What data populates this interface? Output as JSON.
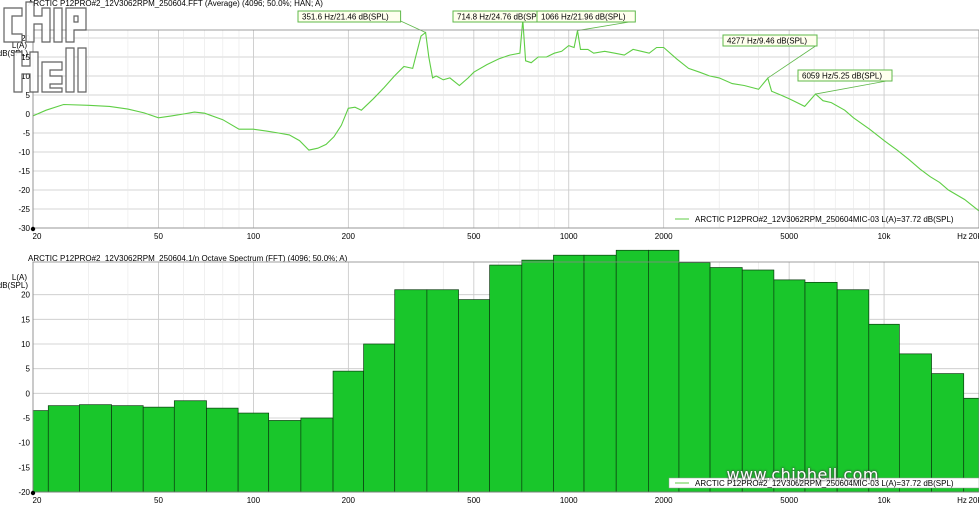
{
  "top_title": "ARCTIC P12PRO#2_12V3062RPM_250604.FFT (Average) (4096; 50.0%; HAN; A)",
  "bottom_title": "ARCTIC P12PRO#2_12V3062RPM_250604.1/n Octave Spectrum (FFT) (4096; 50.0%; A)",
  "watermark": "www.chiphell.com",
  "logo_text": "chip hell",
  "colors": {
    "line": "#5fce45",
    "bar": "#19c62b",
    "grid": "#c8c8c8",
    "callout_bg": "#ffffee",
    "callout_border": "#5fb84a"
  },
  "chart_data": [
    {
      "type": "line",
      "title": "ARCTIC P12PRO#2_12V3062RPM_250604.FFT (Average) (4096; 50.0%; HAN; A)",
      "ylabel": "L(A) dB(SPL)",
      "xlabel": "Hz",
      "xscale": "log",
      "xlim": [
        20,
        20000
      ],
      "ylim": [
        -30,
        20
      ],
      "yticks": [
        20,
        15,
        10,
        5,
        0,
        -5,
        -10,
        -15,
        -20,
        -25,
        -30
      ],
      "xticks": [
        20,
        50,
        100,
        200,
        500,
        1000,
        2000,
        5000,
        10000,
        20000
      ],
      "xtick_labels": [
        "20",
        "50",
        "100",
        "200",
        "500",
        "1000",
        "2000",
        "5000",
        "10k",
        "Hz",
        "20k"
      ],
      "grid": true,
      "legend_position": "bottom-right",
      "series": [
        {
          "name": "ARCTIC P12PRO#2_12V3062RPM_250604MIC-03 L(A)=37.72 dB(SPL)",
          "x": [
            20,
            22,
            25,
            30,
            35,
            40,
            45,
            50,
            55,
            60,
            65,
            70,
            80,
            90,
            100,
            110,
            120,
            130,
            140,
            150,
            160,
            170,
            180,
            190,
            200,
            210,
            220,
            240,
            260,
            280,
            300,
            320,
            340,
            351.6,
            360,
            370,
            380,
            400,
            420,
            450,
            480,
            500,
            550,
            600,
            650,
            700,
            714.8,
            730,
            760,
            800,
            850,
            900,
            950,
            1000,
            1040,
            1066,
            1090,
            1150,
            1200,
            1300,
            1400,
            1500,
            1600,
            1700,
            1800,
            1900,
            2000,
            2200,
            2400,
            2600,
            2800,
            3000,
            3300,
            3600,
            4000,
            4277,
            4400,
            4700,
            5000,
            5300,
            5600,
            6059,
            6400,
            6800,
            7500,
            8000,
            9000,
            10000,
            11000,
            12000,
            13000,
            14000,
            15000,
            16000,
            18000,
            20000
          ],
          "y": [
            -0.5,
            1.0,
            2.5,
            2.3,
            2.0,
            1.3,
            0.3,
            -1.0,
            -0.5,
            0.0,
            0.5,
            0.2,
            -1.5,
            -4.0,
            -4.0,
            -4.5,
            -5.0,
            -5.5,
            -7.0,
            -9.5,
            -9.0,
            -8.0,
            -6.0,
            -3.0,
            1.5,
            1.8,
            1.0,
            4.0,
            7.0,
            10.0,
            12.5,
            12.0,
            20.5,
            21.46,
            15.0,
            9.5,
            10.0,
            9.0,
            9.5,
            7.5,
            9.5,
            11.0,
            13.0,
            14.5,
            15.5,
            16.0,
            24.76,
            14.0,
            13.5,
            15.0,
            15.0,
            16.0,
            16.5,
            18.0,
            17.5,
            21.96,
            17.0,
            17.0,
            16.0,
            16.5,
            16.0,
            15.5,
            17.0,
            16.5,
            16.0,
            17.5,
            17.5,
            14.5,
            12.0,
            11.0,
            10.0,
            9.5,
            8.0,
            7.5,
            6.5,
            9.46,
            6.0,
            5.0,
            4.0,
            3.0,
            2.0,
            5.25,
            3.5,
            3.0,
            1.0,
            -1.0,
            -4.0,
            -7.0,
            -9.5,
            -12.0,
            -14.5,
            -16.5,
            -18.0,
            -20.0,
            -22.5,
            -25.5
          ]
        }
      ],
      "annotations": [
        {
          "x": 351.6,
          "y": 21.46,
          "label": "351.6 Hz/21.46 dB(SPL)"
        },
        {
          "x": 714.8,
          "y": 24.76,
          "label": "714.8 Hz/24.76 dB(SPL)"
        },
        {
          "x": 1066,
          "y": 21.96,
          "label": "1066 Hz/21.96 dB(SPL)"
        },
        {
          "x": 4277,
          "y": 9.46,
          "label": "4277 Hz/9.46 dB(SPL)"
        },
        {
          "x": 6059,
          "y": 5.25,
          "label": "6059 Hz/5.25 dB(SPL)"
        }
      ]
    },
    {
      "type": "bar",
      "title": "ARCTIC P12PRO#2_12V3062RPM_250604.1/n Octave Spectrum (FFT) (4096; 50.0%; A)",
      "ylabel": "L(A) dB(SPL)",
      "xlabel": "Hz",
      "xscale": "log",
      "xlim": [
        20,
        20000
      ],
      "ylim": [
        -20,
        25
      ],
      "yticks": [
        20,
        15,
        10,
        5,
        0,
        -5,
        -10,
        -15,
        -20
      ],
      "xticks": [
        20,
        50,
        100,
        200,
        500,
        1000,
        2000,
        5000,
        10000,
        20000
      ],
      "xtick_labels": [
        "20",
        "50",
        "100",
        "200",
        "500",
        "1000",
        "2000",
        "5000",
        "10k",
        "Hz",
        "20k"
      ],
      "grid": true,
      "legend_position": "bottom-right",
      "series": [
        {
          "name": "ARCTIC P12PRO#2_12V3062RPM_250604MIC-03 L(A)=37.72 dB(SPL)",
          "centers": [
            20,
            25,
            31.5,
            40,
            50,
            63,
            80,
            100,
            125,
            160,
            200,
            250,
            315,
            400,
            500,
            630,
            800,
            1000,
            1250,
            1600,
            2000,
            2500,
            3150,
            4000,
            5000,
            6300,
            8000,
            10000,
            12500,
            16000,
            20000
          ],
          "values": [
            -3.5,
            -2.5,
            -2.3,
            -2.5,
            -2.8,
            -1.5,
            -3.0,
            -4.0,
            -5.5,
            -5.0,
            4.5,
            10.0,
            21.0,
            21.0,
            19.0,
            26.0,
            27.0,
            28.0,
            28.0,
            29.0,
            29.0,
            26.5,
            25.5,
            25.0,
            23.0,
            22.5,
            21.0,
            14.0,
            8.0,
            4.0,
            -1.0
          ]
        }
      ]
    }
  ]
}
